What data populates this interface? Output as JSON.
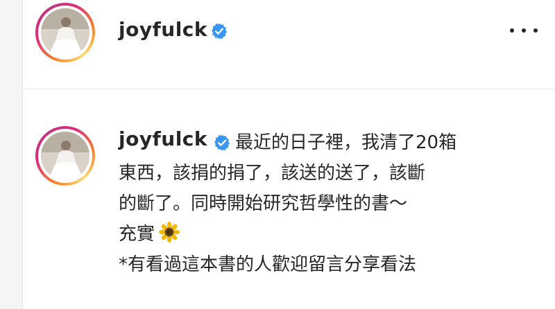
{
  "post_header": {
    "username": "joyfulck",
    "verified_icon": "verified-badge-icon",
    "more_icon": "more-options-icon"
  },
  "caption": {
    "username": "joyfulck",
    "lines": [
      "最近的日子裡，我清了20箱",
      "東西，該捐的捐了，該送的送了，該斷",
      "的斷了。同時開始研究哲學性的書～",
      "充實",
      "*有看過這本書的人歡迎留言分享看法"
    ],
    "emoji": "sunflower-icon"
  },
  "colors": {
    "verified_blue": "#3897f0",
    "text": "#262626",
    "divider": "#e4e4e4"
  }
}
